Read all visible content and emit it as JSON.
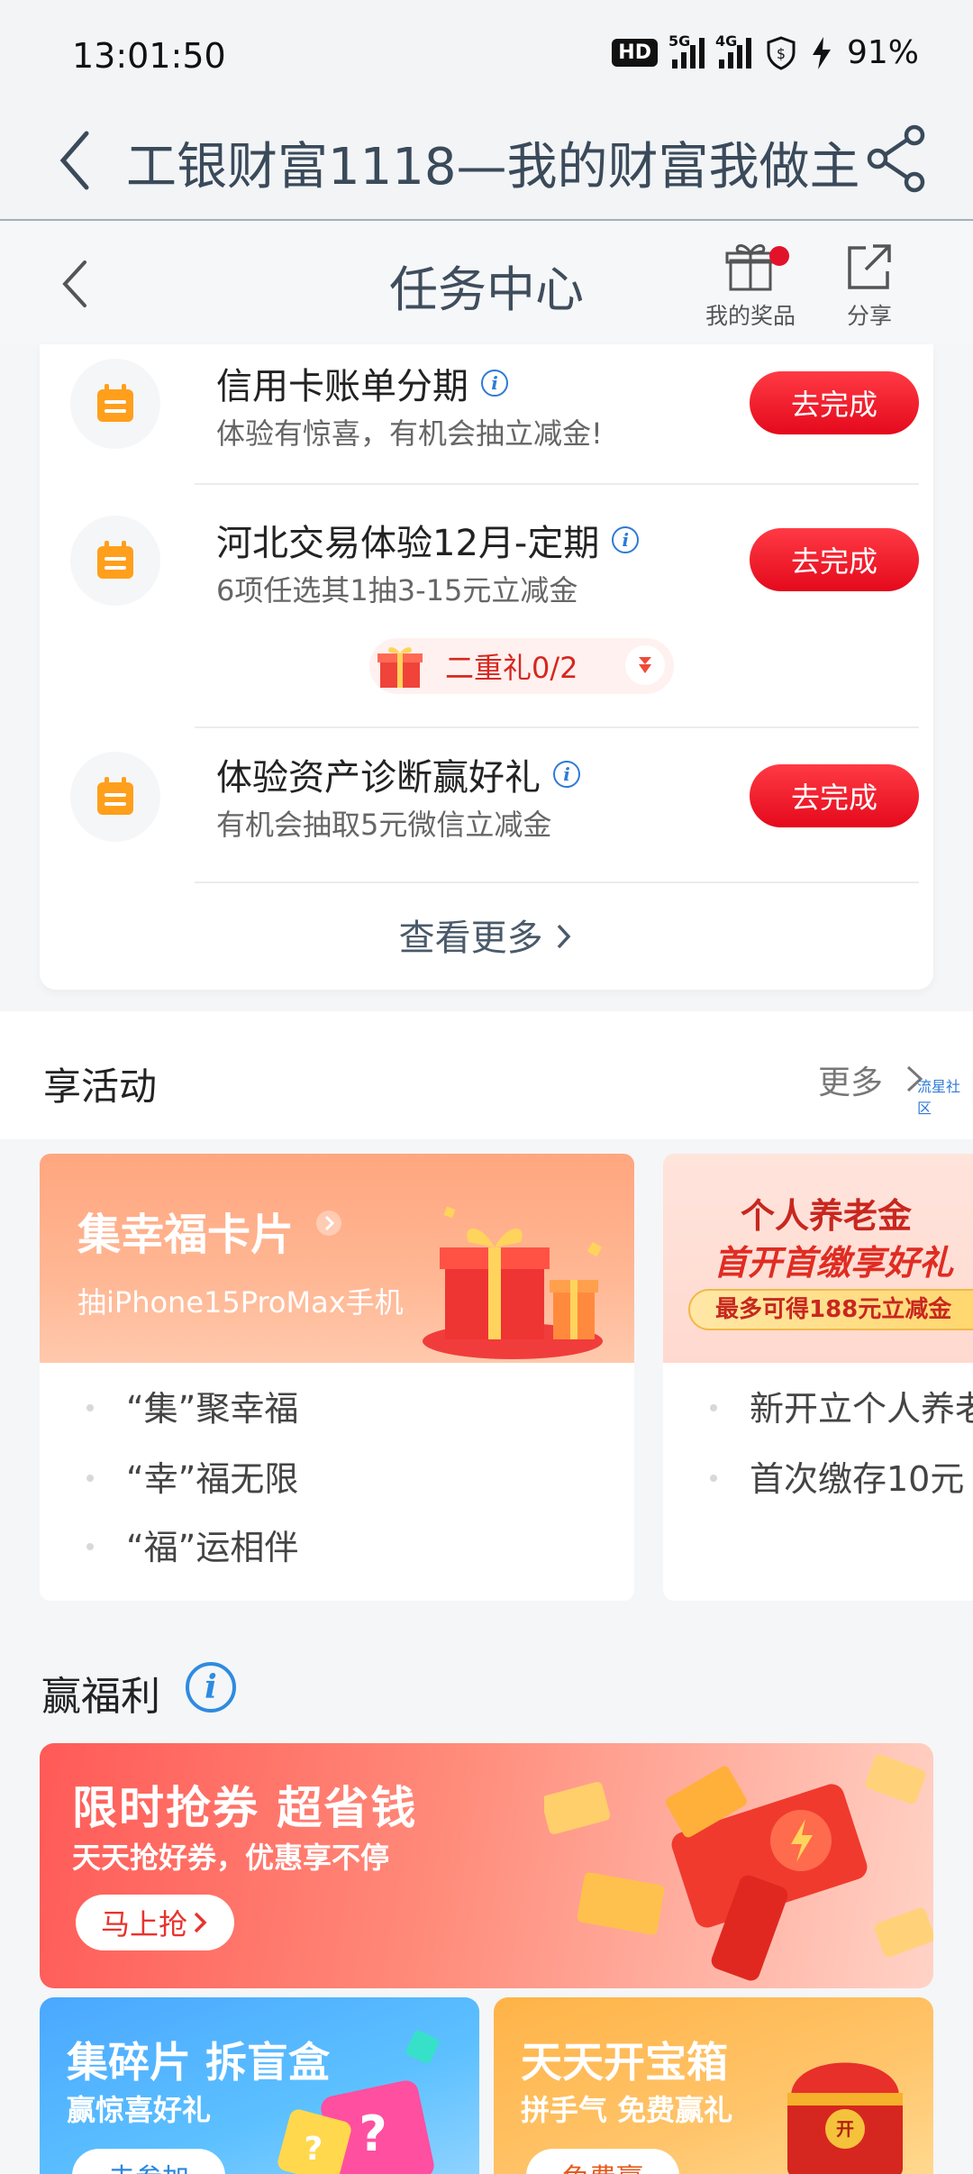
{
  "status_bar": {
    "time": "13:01:50",
    "hd": "HD",
    "net1": "5G",
    "net2": "4G",
    "battery": "91%"
  },
  "browser_header": {
    "title": "工银财富1118—我的财富我做主"
  },
  "task_header": {
    "title": "任务中心",
    "prize_label": "我的奖品",
    "share_label": "分享"
  },
  "tasks": [
    {
      "name": "信用卡账单分期",
      "desc": "体验有惊喜，有机会抽立减金!",
      "button": "去完成"
    },
    {
      "name": "河北交易体验12月-定期",
      "desc": "6项任选其1抽3-15元立减金",
      "button": "去完成",
      "gift": "二重礼0/2"
    },
    {
      "name": "体验资产诊断赢好礼",
      "desc": "有机会抽取5元微信立减金",
      "button": "去完成"
    }
  ],
  "see_more": "查看更多",
  "activities": {
    "title": "享活动",
    "more": "更多",
    "tiny_label": "流星社区",
    "cards": [
      {
        "banner_title": "集幸福卡片",
        "banner_sub": "抽iPhone15ProMax手机",
        "items": [
          "“集”聚幸福",
          "“幸”福无限",
          "“福”运相伴"
        ]
      },
      {
        "banner_line1": "个人养老金",
        "banner_line2": "首开首缴享好礼",
        "banner_line3": "最多可得188元立减金",
        "items": [
          "新开立个人养老",
          "首次缴存10元"
        ]
      }
    ]
  },
  "welfare": {
    "title": "赢福利",
    "banner": {
      "title": "限时抢券 超省钱",
      "sub": "天天抢好券，优惠享不停",
      "button": "马上抢"
    },
    "card_left": {
      "title": "集碎片 拆盲盒",
      "sub": "赢惊喜好礼",
      "button": "去参加"
    },
    "card_right": {
      "title": "天天开宝箱",
      "sub": "拼手气 免费赢礼",
      "button": "免费赢",
      "chest_label": "开"
    }
  }
}
